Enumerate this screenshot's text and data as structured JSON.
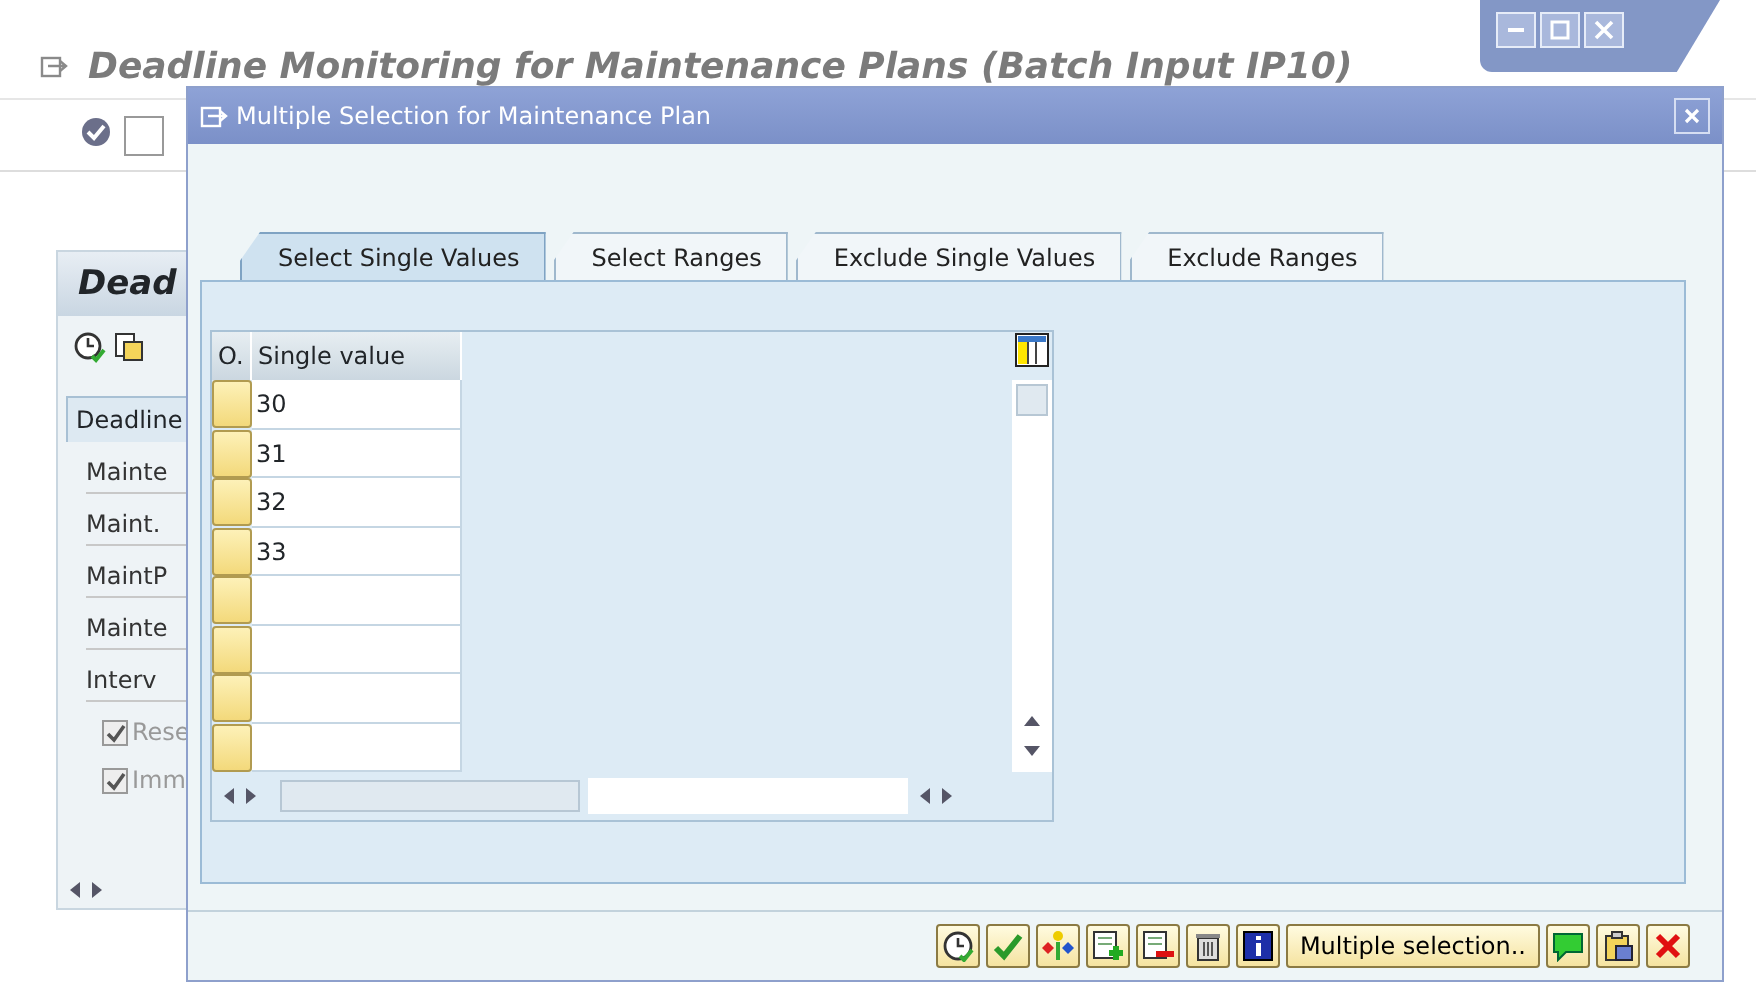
{
  "window": {
    "title": "Deadline Monitoring for Maintenance Plans (Batch Input IP10)"
  },
  "background_screen": {
    "heading": "Dead",
    "tab": "Deadline",
    "field_labels": [
      "Mainte",
      "Maint.",
      "MaintP",
      "Mainte",
      "Interv"
    ],
    "checkboxes": [
      {
        "label": "Rese",
        "checked": true,
        "disabled": true
      },
      {
        "label": "Imm",
        "checked": true,
        "disabled": true
      }
    ]
  },
  "dialog": {
    "title": "Multiple Selection for Maintenance Plan",
    "tabs": [
      {
        "label": "Select Single Values",
        "selected": true
      },
      {
        "label": "Select Ranges",
        "selected": false
      },
      {
        "label": "Exclude Single Values",
        "selected": false
      },
      {
        "label": "Exclude Ranges",
        "selected": false
      }
    ],
    "table": {
      "columns": [
        "O.",
        "Single value"
      ],
      "rows": [
        {
          "kind": "entry",
          "value": "30"
        },
        {
          "kind": "entry",
          "value": "31"
        },
        {
          "kind": "entry",
          "value": "32"
        },
        {
          "kind": "entry",
          "value": "33"
        },
        {
          "kind": "blank"
        },
        {
          "kind": "blank"
        },
        {
          "kind": "blank"
        },
        {
          "kind": "blank"
        }
      ]
    },
    "multiple_selection_button": "Multiple selection.."
  }
}
